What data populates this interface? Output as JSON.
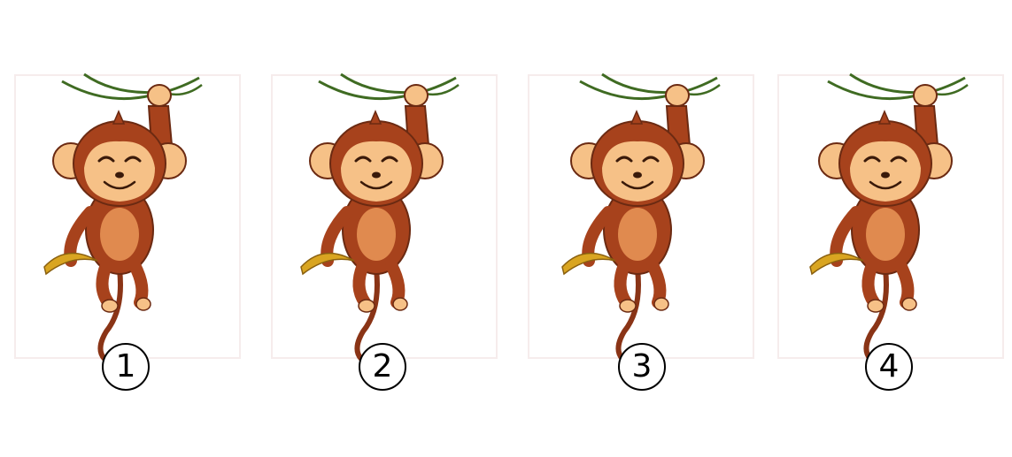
{
  "items": [
    {
      "label": "1"
    },
    {
      "label": "2"
    },
    {
      "label": "3"
    },
    {
      "label": "4"
    }
  ],
  "colors": {
    "fur": "#a7421c",
    "fur_dark": "#6b2a12",
    "face": "#f6c187",
    "belly": "#e08a4f",
    "vine": "#3f6b22",
    "banana": "#d9a521"
  }
}
